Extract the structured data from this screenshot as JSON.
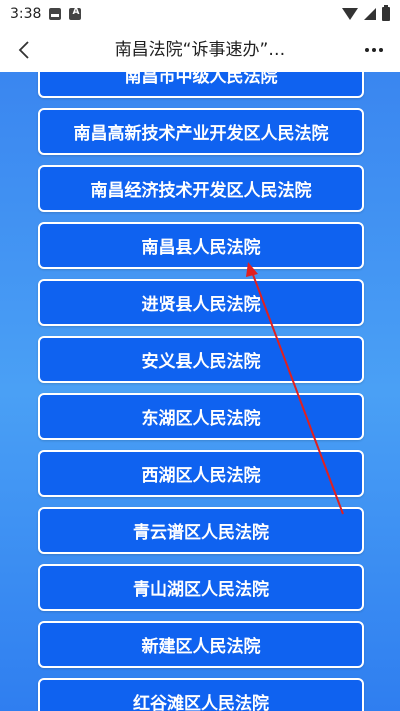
{
  "status_bar": {
    "time": "3:38"
  },
  "nav": {
    "title": "南昌法院“诉事速办”…"
  },
  "courts": [
    {
      "label": "南昌市中级人民法院"
    },
    {
      "label": "南昌高新技术产业开发区人民法院"
    },
    {
      "label": "南昌经济技术开发区人民法院"
    },
    {
      "label": "南昌县人民法院"
    },
    {
      "label": "进贤县人民法院"
    },
    {
      "label": "安义县人民法院"
    },
    {
      "label": "东湖区人民法院"
    },
    {
      "label": "西湖区人民法院"
    },
    {
      "label": "青云谱区人民法院"
    },
    {
      "label": "青山湖区人民法院"
    },
    {
      "label": "新建区人民法院"
    },
    {
      "label": "红谷滩区人民法院"
    }
  ],
  "colors": {
    "accent": "#0f62f0",
    "background_gradient": "#3a86f0",
    "arrow": "#e02020"
  }
}
